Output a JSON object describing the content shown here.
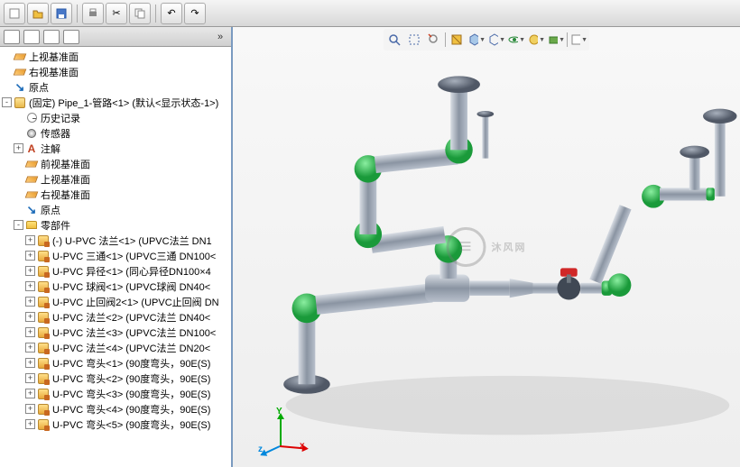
{
  "toolbar": {
    "icons": [
      "new",
      "open",
      "save",
      "print",
      "cut",
      "copy",
      "paste",
      "undo",
      "redo"
    ]
  },
  "view_tools": {
    "items": [
      "zoom-fit",
      "zoom-area",
      "zoom-prev",
      "section",
      "view-orient",
      "display-style",
      "hide-show",
      "scene",
      "render",
      "sheet",
      "snapshot",
      "options"
    ]
  },
  "tree": {
    "nodes": [
      {
        "icon": "plane",
        "label": "上视基准面",
        "indent": 0,
        "exp": null
      },
      {
        "icon": "plane",
        "label": "右视基准面",
        "indent": 0,
        "exp": null
      },
      {
        "icon": "origin",
        "label": "原点",
        "indent": 0,
        "exp": null
      },
      {
        "icon": "asm",
        "label": "(固定) Pipe_1-管路<1> (默认<显示状态-1>)",
        "indent": 0,
        "exp": "-"
      },
      {
        "icon": "hist",
        "label": "历史记录",
        "indent": 1,
        "exp": null
      },
      {
        "icon": "sens",
        "label": "传感器",
        "indent": 1,
        "exp": null
      },
      {
        "icon": "ann",
        "label": "注解",
        "indent": 1,
        "exp": "+"
      },
      {
        "icon": "plane",
        "label": "前视基准面",
        "indent": 1,
        "exp": null
      },
      {
        "icon": "plane",
        "label": "上视基准面",
        "indent": 1,
        "exp": null
      },
      {
        "icon": "plane",
        "label": "右视基准面",
        "indent": 1,
        "exp": null
      },
      {
        "icon": "origin",
        "label": "原点",
        "indent": 1,
        "exp": null
      },
      {
        "icon": "fold",
        "label": "零部件",
        "indent": 1,
        "exp": "-"
      },
      {
        "icon": "part",
        "label": "(-) U-PVC 法兰<1> (UPVC法兰 DN1",
        "indent": 2,
        "exp": "+"
      },
      {
        "icon": "part",
        "label": "U-PVC 三通<1> (UPVC三通 DN100<",
        "indent": 2,
        "exp": "+"
      },
      {
        "icon": "part",
        "label": "U-PVC 异径<1> (同心异径DN100×4",
        "indent": 2,
        "exp": "+"
      },
      {
        "icon": "part",
        "label": "U-PVC 球阀<1> (UPVC球阀 DN40<",
        "indent": 2,
        "exp": "+"
      },
      {
        "icon": "part",
        "label": "U-PVC 止回阀2<1> (UPVC止回阀 DN",
        "indent": 2,
        "exp": "+"
      },
      {
        "icon": "part",
        "label": "U-PVC 法兰<2> (UPVC法兰 DN40<",
        "indent": 2,
        "exp": "+"
      },
      {
        "icon": "part",
        "label": "U-PVC 法兰<3> (UPVC法兰 DN100<",
        "indent": 2,
        "exp": "+"
      },
      {
        "icon": "part",
        "label": "U-PVC 法兰<4> (UPVC法兰 DN20<",
        "indent": 2,
        "exp": "+"
      },
      {
        "icon": "part",
        "label": "U-PVC 弯头<1> (90度弯头，90E(S)",
        "indent": 2,
        "exp": "+"
      },
      {
        "icon": "part",
        "label": "U-PVC 弯头<2> (90度弯头，90E(S)",
        "indent": 2,
        "exp": "+"
      },
      {
        "icon": "part",
        "label": "U-PVC 弯头<3> (90度弯头，90E(S)",
        "indent": 2,
        "exp": "+"
      },
      {
        "icon": "part",
        "label": "U-PVC 弯头<4> (90度弯头，90E(S)",
        "indent": 2,
        "exp": "+"
      },
      {
        "icon": "part",
        "label": "U-PVC 弯头<5> (90度弯头，90E(S)",
        "indent": 2,
        "exp": "+"
      }
    ]
  },
  "triad": {
    "x": "x",
    "y": "Y",
    "z": "z"
  },
  "watermark": {
    "text": "沐风网",
    "logo": "≡"
  },
  "colors": {
    "elbow": "#3cc84a",
    "pipe": "#9aa4b0",
    "flange": "#707880",
    "valve": "#d02828"
  }
}
